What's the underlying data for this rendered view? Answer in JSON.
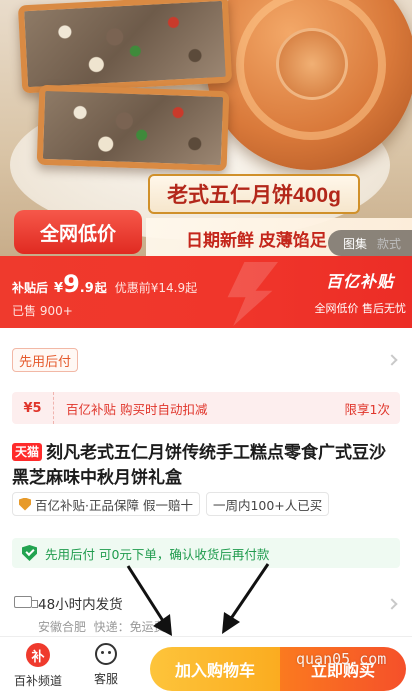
{
  "hero": {
    "product_banner": "老式五仁月饼400g",
    "low_price_badge": "全网低价",
    "tagline": "日期新鲜 皮薄馅足",
    "gallery_tabs": [
      "图集",
      "款式"
    ]
  },
  "price_bar": {
    "label": "补贴后",
    "currency": "¥",
    "price_int": "9",
    "price_dec": ".9",
    "price_suffix": "起",
    "original_price": "优惠前¥14.9起",
    "sold": "已售 900+",
    "brand": "百亿补贴",
    "brand_sub": "全网低价 售后无忧"
  },
  "pay_later_tag": "先用后付",
  "coupon": {
    "amount": "¥5",
    "text": "百亿补贴 购买时自动扣减",
    "limit": "限享1次"
  },
  "product": {
    "platform_tag": "天猫",
    "title": "刻凡老式五仁月饼传统手工糕点零食广式豆沙黑芝麻味中秋月饼礼盒"
  },
  "guarantees": {
    "primary": "百亿补贴·正品保障 假一赔十",
    "sales": "一周内100+人已买"
  },
  "pay_banner": "先用后付 可0元下单，确认收货后再付款",
  "shipping": {
    "title": "48小时内发货",
    "origin": "安徽合肥",
    "fee": "快递：免运费"
  },
  "bottom_bar": {
    "subsidy_icon_text": "补",
    "subsidy_label": "百补频道",
    "service_label": "客服",
    "add_to_cart": "加入购物车",
    "buy_now": "立即购买"
  },
  "watermark": "quan05.com",
  "colors": {
    "brand_red": "#ef3a2d",
    "cart_yellow": "#fbac20",
    "buy_orange": "#f5502a",
    "success_green": "#22a350"
  }
}
